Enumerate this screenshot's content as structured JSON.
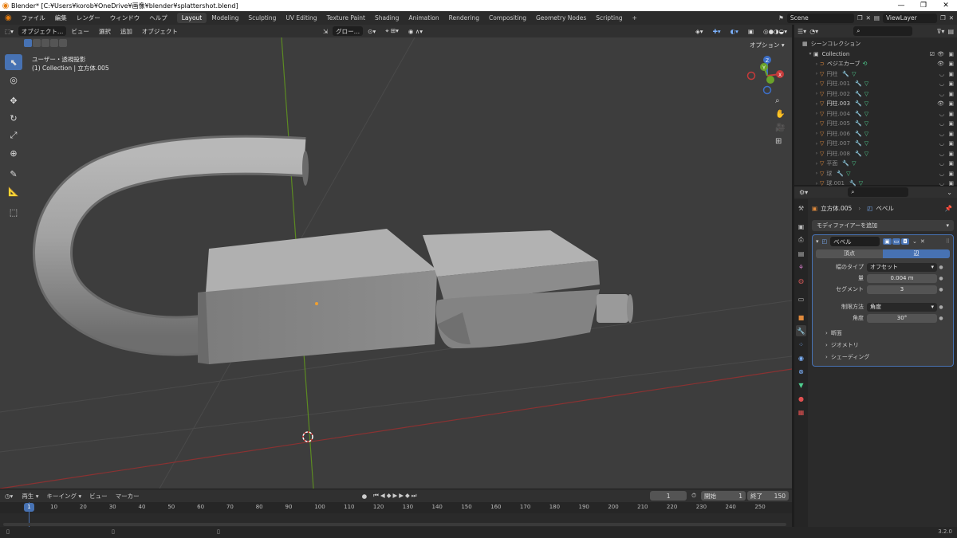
{
  "window": {
    "title": "Blender* [C:¥Users¥korob¥OneDrive¥画像¥blender¥splattershot.blend]",
    "controls": [
      "—",
      "❐",
      "✕"
    ]
  },
  "menu": {
    "items": [
      "ファイル",
      "編集",
      "レンダー",
      "ウィンドウ",
      "ヘルプ"
    ],
    "workspaces": [
      "Layout",
      "Modeling",
      "Sculpting",
      "UV Editing",
      "Texture Paint",
      "Shading",
      "Animation",
      "Rendering",
      "Compositing",
      "Geometry Nodes",
      "Scripting"
    ],
    "active_workspace": "Layout",
    "add_tab": "+",
    "scene": "Scene",
    "view_layer": "ViewLayer"
  },
  "viewport": {
    "mode": "オブジェクト…",
    "menus": [
      "ビュー",
      "選択",
      "追加",
      "オブジェクト"
    ],
    "transform": "グロー…",
    "options": "オプション",
    "view_name": "ユーザー・透視投影",
    "object_info": "(1) Collection | 立方体.005",
    "gizmo": {
      "x": "X",
      "y": "Y",
      "z": "Z"
    }
  },
  "timeline": {
    "menus": [
      "再生",
      "キーイング",
      "ビュー",
      "マーカー"
    ],
    "current_frame": "1",
    "start_label": "開始",
    "start": "1",
    "end_label": "終了",
    "end": "150",
    "ticks": [
      "1",
      "10",
      "20",
      "30",
      "40",
      "50",
      "60",
      "70",
      "80",
      "90",
      "100",
      "110",
      "120",
      "130",
      "140",
      "150",
      "160",
      "170",
      "180",
      "190",
      "200",
      "210",
      "220",
      "230",
      "240",
      "250"
    ]
  },
  "status": {
    "version": "3.2.0"
  },
  "outliner": {
    "scene_collection": "シーンコレクション",
    "collection": "Collection",
    "objects": [
      {
        "name": "ベジエカーブ",
        "dim": false,
        "visible": true
      },
      {
        "name": "円柱",
        "dim": true,
        "visible": false
      },
      {
        "name": "円柱.001",
        "dim": true,
        "visible": false
      },
      {
        "name": "円柱.002",
        "dim": true,
        "visible": false
      },
      {
        "name": "円柱.003",
        "dim": false,
        "visible": true
      },
      {
        "name": "円柱.004",
        "dim": true,
        "visible": false
      },
      {
        "name": "円柱.005",
        "dim": true,
        "visible": false
      },
      {
        "name": "円柱.006",
        "dim": true,
        "visible": false
      },
      {
        "name": "円柱.007",
        "dim": true,
        "visible": false
      },
      {
        "name": "円柱.008",
        "dim": true,
        "visible": false
      },
      {
        "name": "平面",
        "dim": true,
        "visible": false
      },
      {
        "name": "球",
        "dim": true,
        "visible": false
      },
      {
        "name": "球.001",
        "dim": true,
        "visible": false
      }
    ]
  },
  "properties": {
    "breadcrumb_object": "立方体.005",
    "breadcrumb_modifier": "ベベル",
    "add_modifier": "モディファイアーを追加",
    "modifier_name": "ベベル",
    "tabs": {
      "vertex": "頂点",
      "edge": "辺"
    },
    "active_tab": "辺",
    "fields": [
      {
        "label": "幅のタイプ",
        "value": "オフセット",
        "dropdown": true
      },
      {
        "label": "量",
        "value": "0.004 m",
        "dropdown": false
      },
      {
        "label": "セグメント",
        "value": "3",
        "dropdown": false
      }
    ],
    "limit_fields": [
      {
        "label": "制限方法",
        "value": "角度",
        "dropdown": true
      },
      {
        "label": "角度",
        "value": "30°",
        "dropdown": false
      }
    ],
    "subpanels": [
      "断面",
      "ジオメトリ",
      "シェーディング"
    ]
  },
  "colors": {
    "accent": "#4772b3",
    "object_orange": "#e08a3c",
    "x_axis": "#c63a3a",
    "y_axis": "#6aa22a",
    "z_axis": "#3d6fc7"
  }
}
